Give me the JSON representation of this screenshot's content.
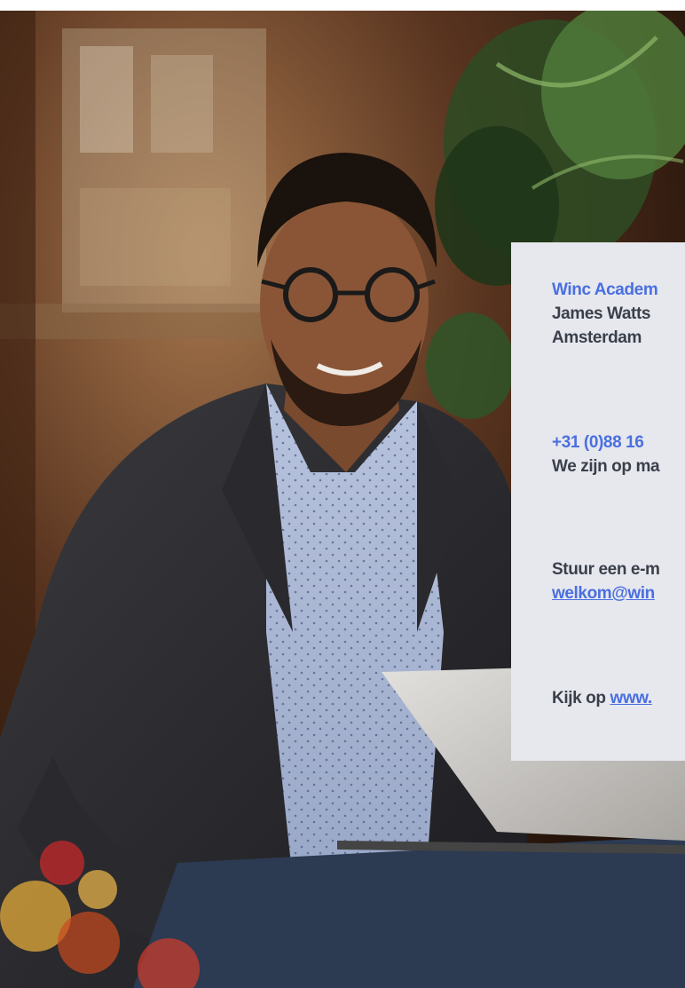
{
  "colors": {
    "accent": "#4a6fe0",
    "text": "#3a3f4a",
    "card_background": "#e6e8ee"
  },
  "photo": {
    "subject": "man-with-glasses-holding-laptop"
  },
  "contact_card": {
    "company": "Winc Academ",
    "street": "James Watts",
    "city": "Amsterdam",
    "phone": "+31 (0)88 16",
    "hours": "We zijn op ma",
    "email_prompt": "Stuur een e-m",
    "email": "welkom@win",
    "website_prefix": "Kijk op",
    "website": "www."
  }
}
